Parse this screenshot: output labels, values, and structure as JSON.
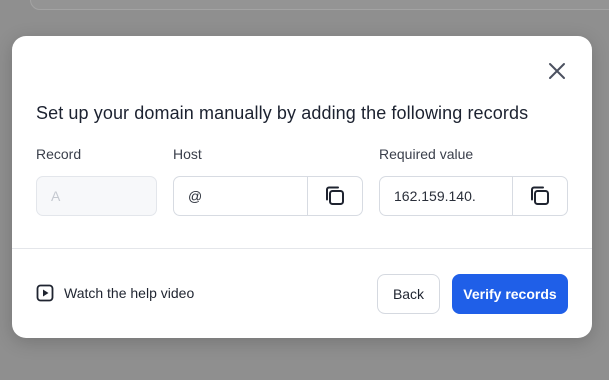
{
  "modal": {
    "title": "Set up your domain manually by adding the following records",
    "columns": {
      "record": "Record",
      "host": "Host",
      "required_value": "Required value"
    },
    "fields": {
      "record_value": "A",
      "host_value": "@",
      "required_value": "162.159.140."
    },
    "help_link_label": "Watch the help video",
    "back_label": "Back",
    "verify_label": "Verify records"
  },
  "icons": {
    "close": "close-icon",
    "copy": "copy-icon",
    "play": "play-icon"
  },
  "colors": {
    "primary": "#1f5fe8",
    "backdrop": "#8f8f8f"
  }
}
